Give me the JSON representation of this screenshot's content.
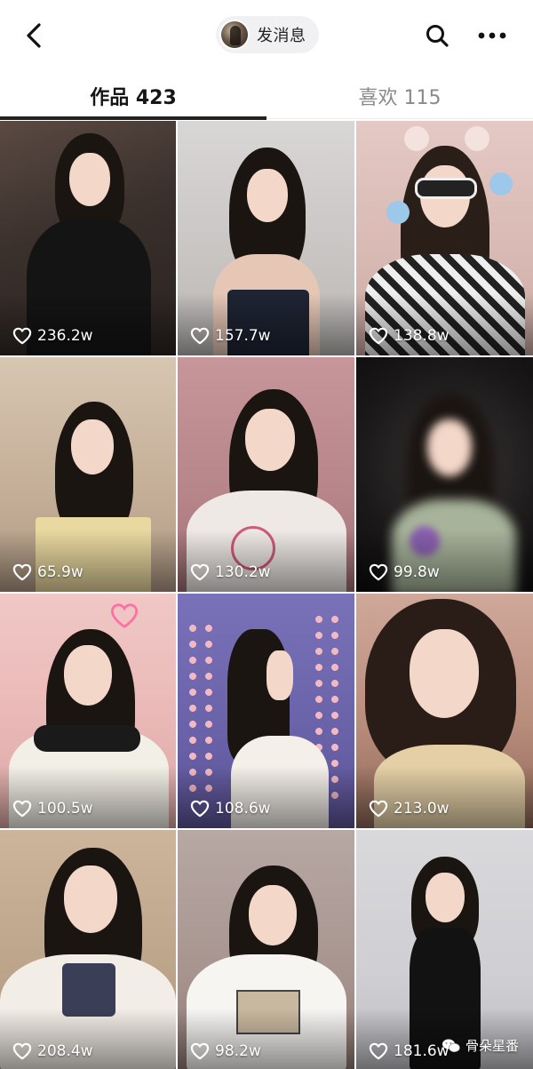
{
  "header": {
    "back_icon": "chevron-left-icon",
    "message_button_label": "发消息",
    "search_icon": "search-icon",
    "more_icon": "more-horizontal-icon"
  },
  "tabs": [
    {
      "label": "作品 423",
      "active": true
    },
    {
      "label": "喜欢 115",
      "active": false
    }
  ],
  "grid": {
    "like_icon": "heart-outline-icon",
    "items": [
      {
        "likes": "236.2w"
      },
      {
        "likes": "157.7w"
      },
      {
        "likes": "138.8w"
      },
      {
        "likes": "65.9w"
      },
      {
        "likes": "130.2w"
      },
      {
        "likes": "99.8w"
      },
      {
        "likes": "100.5w"
      },
      {
        "likes": "108.6w"
      },
      {
        "likes": "213.0w"
      },
      {
        "likes": "208.4w"
      },
      {
        "likes": "98.2w"
      },
      {
        "likes": "181.6w"
      }
    ]
  },
  "watermark": {
    "text": "骨朵星番",
    "icon": "wechat-icon"
  },
  "colors": {
    "tab_active": "#161616",
    "tab_inactive": "#8a8a8a",
    "pill_bg": "#f1f1f3"
  }
}
